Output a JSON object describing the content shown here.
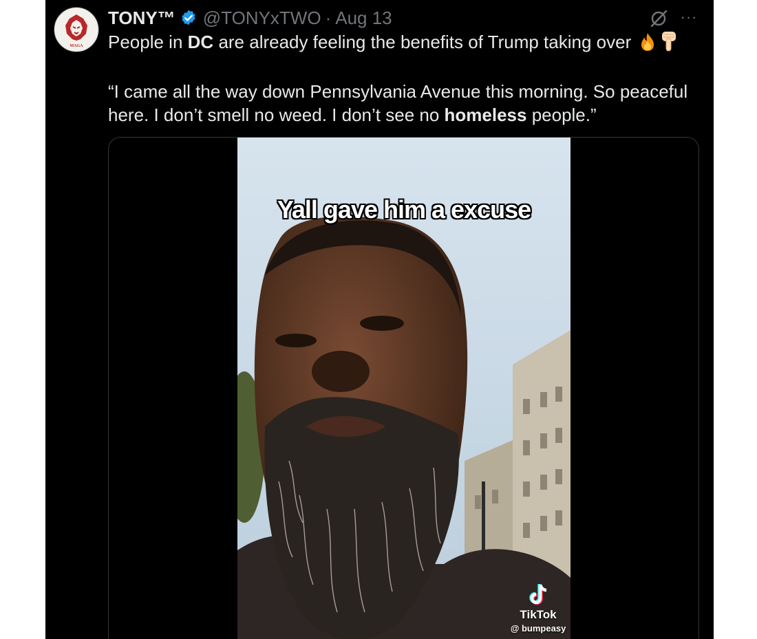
{
  "tweet": {
    "author_name": "TONY™",
    "handle": "@TONYxTWO",
    "separator": "·",
    "date": "Aug 13",
    "avatar_text": "MAGA",
    "more_label": "···",
    "line1": {
      "pre": "People in ",
      "bold": "DC",
      "post": " are already feeling the benefits of Trump taking over "
    },
    "line2": {
      "pre": "“I came all the way down Pennsylvania Avenue this morning. So peaceful here. I don’t smell no weed. I don’t see no ",
      "bold": "homeless",
      "post": " people.”"
    },
    "emojis": [
      "fire-icon",
      "pointing-down-icon"
    ]
  },
  "media": {
    "caption": "Yall gave him a excuse",
    "watermark_brand": "TikTok",
    "watermark_user": "@ bumpeasy"
  },
  "colors": {
    "background": "#000000",
    "text": "#e7e9ea",
    "muted": "#71767b",
    "verified": "#1d9bf0",
    "border": "#333639"
  }
}
